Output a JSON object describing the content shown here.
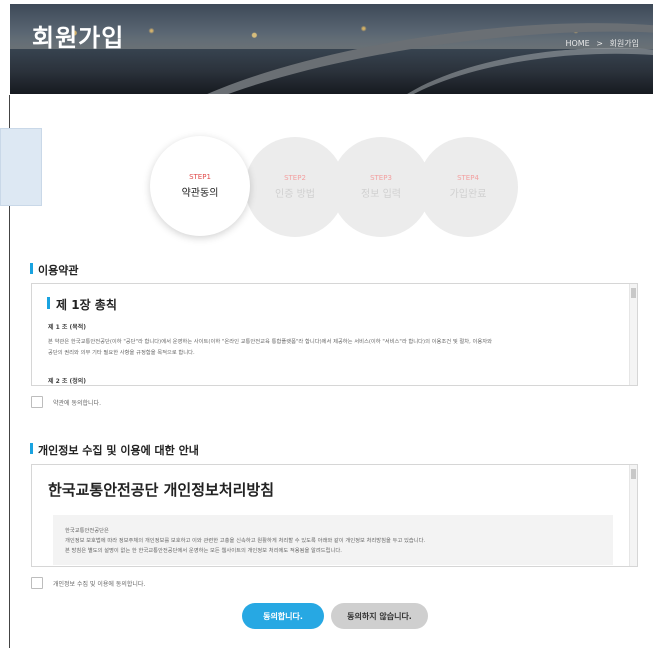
{
  "header": {
    "title": "회원가입",
    "breadcrumb": {
      "home": "HOME",
      "separator": ">",
      "current": "회원가입"
    }
  },
  "steps": [
    {
      "code": "STEP1",
      "name": "약관동의",
      "active": true
    },
    {
      "code": "STEP2",
      "name": "인증 방법",
      "active": false
    },
    {
      "code": "STEP3",
      "name": "정보 입력",
      "active": false
    },
    {
      "code": "STEP4",
      "name": "가입완료",
      "active": false
    }
  ],
  "terms": {
    "section_title": "이용약관",
    "chapter": "제 1장 총칙",
    "article1_title": "제 1 조 (목적)",
    "article1_line1": "본 약관은 한국교통안전공단(이하 \"공단\"라 합니다)에서 운영하는 사이트(이하 \"온라인 교통안전교육 통합플랫폼\"라 합니다)에서 제공하는 서비스(이하 \"서비스\"라 합니다)의 이용조건 및 절차, 이용자와",
    "article1_line2": "공단의 권리와 의무 기타 필요한 사항을 규정함을 목적으로 합니다.",
    "article2_title": "제 2 조 (정의)",
    "agree_label": "약관에 동의합니다."
  },
  "privacy": {
    "section_title": "개인정보 수집 및 이용에 대한 안내",
    "policy_title": "한국교통안전공단 개인정보처리방침",
    "org": "한국교통안전공단은",
    "line1": "개인정보 보호법에 따라 정보주체의 개인정보를 보호하고 이와 관련한 고충을 신속하고 원활하게 처리할 수 있도록 아래와 같이 개인정보 처리방침을 두고 있습니다.",
    "line2": "본 방침은 별도의 설명이 없는 한 한국교통안전공단에서 운영하는 모든 웹사이트의 개인정보 처리에도 적용됨을 알려드립니다.",
    "agree_label": "개인정보 수집 및 이용에 동의합니다."
  },
  "buttons": {
    "agree": "동의합니다.",
    "disagree": "동의하지 않습니다."
  },
  "colors": {
    "accent": "#27a8e3",
    "step_active": "#e04b4b"
  }
}
